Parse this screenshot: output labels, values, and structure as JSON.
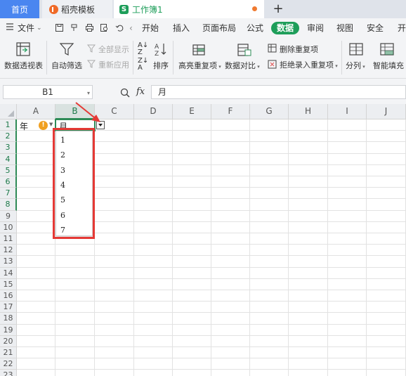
{
  "tabs": {
    "home": "首页",
    "template": "稻壳模板",
    "workbook": "工作簿1",
    "new_tab": "+"
  },
  "menu": {
    "file": "文件",
    "items": [
      "开始",
      "插入",
      "页面布局",
      "公式",
      "数据",
      "审阅",
      "视图",
      "安全",
      "开"
    ],
    "active": "数据"
  },
  "ribbon": {
    "pivot": "数据透视表",
    "autofilter": "自动筛选",
    "show_all": "全部显示",
    "reapply": "重新应用",
    "sort": "排序",
    "highlight_dup": "高亮重复项",
    "compare": "数据对比",
    "remove_dup": "删除重复项",
    "reject_dup": "拒绝录入重复项",
    "split": "分列",
    "smart_fill": "智能填充"
  },
  "formula_bar": {
    "name_box": "B1",
    "fx": "fx",
    "value": "月"
  },
  "columns": [
    "A",
    "B",
    "C",
    "D",
    "E",
    "F",
    "G",
    "H",
    "I",
    "J"
  ],
  "rows": [
    "1",
    "2",
    "3",
    "4",
    "5",
    "6",
    "7",
    "8",
    "9",
    "10",
    "11",
    "12",
    "13",
    "14",
    "15",
    "16",
    "17",
    "18",
    "19",
    "20",
    "21",
    "22",
    "23"
  ],
  "cells": {
    "A1": "年",
    "B1": "月"
  },
  "dropdown_options": [
    "1",
    "2",
    "3",
    "4",
    "5",
    "6",
    "7"
  ],
  "colors": {
    "accent": "#1e9e5a",
    "home_tab": "#4a86f0",
    "annotation": "#e53935"
  }
}
